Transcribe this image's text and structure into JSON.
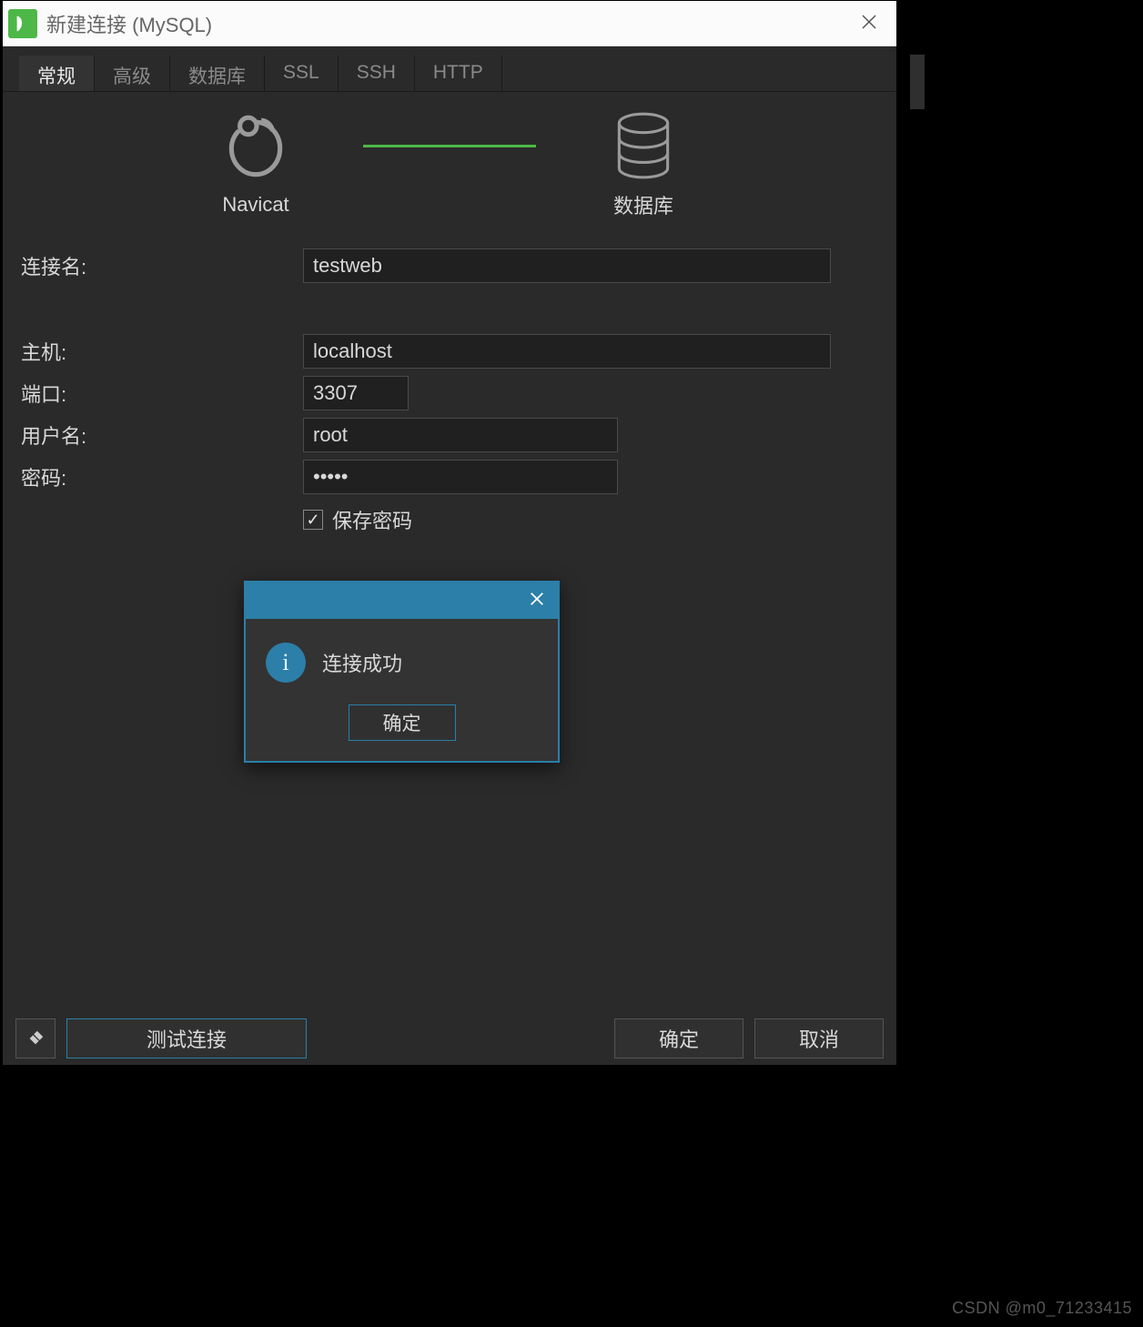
{
  "window": {
    "title": "新建连接 (MySQL)"
  },
  "tabs": {
    "items": [
      "常规",
      "高级",
      "数据库",
      "SSL",
      "SSH",
      "HTTP"
    ],
    "active_index": 0
  },
  "diagram": {
    "left_label": "Navicat",
    "right_label": "数据库"
  },
  "form": {
    "conn_name_label": "连接名:",
    "conn_name_value": "testweb",
    "host_label": "主机:",
    "host_value": "localhost",
    "port_label": "端口:",
    "port_value": "3307",
    "user_label": "用户名:",
    "user_value": "root",
    "password_label": "密码:",
    "password_value": "•••••",
    "save_password_label": "保存密码",
    "save_password_checked": true
  },
  "footer": {
    "test_label": "测试连接",
    "ok_label": "确定",
    "cancel_label": "取消"
  },
  "dialog": {
    "message": "连接成功",
    "ok_label": "确定"
  },
  "watermark": "CSDN @m0_71233415"
}
